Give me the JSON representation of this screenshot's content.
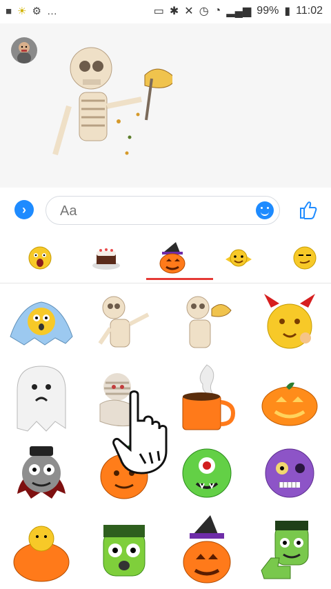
{
  "status_bar": {
    "battery": "99%",
    "time": "11:02",
    "left_icons": [
      "video-icon",
      "weather-icon",
      "android-icon",
      "more-icon"
    ],
    "right_icons": [
      "cast-icon",
      "bluetooth-icon",
      "mute-icon",
      "alarm-icon",
      "wifi-icon",
      "signal-icon",
      "battery-icon"
    ]
  },
  "composer": {
    "placeholder": "Aa"
  },
  "sticker_tabs": [
    {
      "name": "emoji-shocked",
      "active": false
    },
    {
      "name": "cake",
      "active": false
    },
    {
      "name": "halloween-pumpkin",
      "active": true
    },
    {
      "name": "emoji-flying",
      "active": false
    },
    {
      "name": "emoji-smirk",
      "active": false
    }
  ],
  "stickers": [
    [
      "ghost-emoji",
      "skeleton-dancing",
      "skeleton-eating-taco",
      "devil-emoji"
    ],
    [
      "ghost",
      "mummy",
      "ghost-coffee-cup",
      "jack-o-lantern"
    ],
    [
      "vampire-emoji",
      "pumpkin-emoji",
      "cyclops-monster",
      "zombie-emoji"
    ],
    [
      "pumpkin-basket",
      "frankenstein-emoji",
      "pumpkin-witch-hat",
      "frankenstein-thumbs-up"
    ]
  ],
  "colors": {
    "accent": "#1e8bff",
    "active_tab": "#e53935"
  }
}
